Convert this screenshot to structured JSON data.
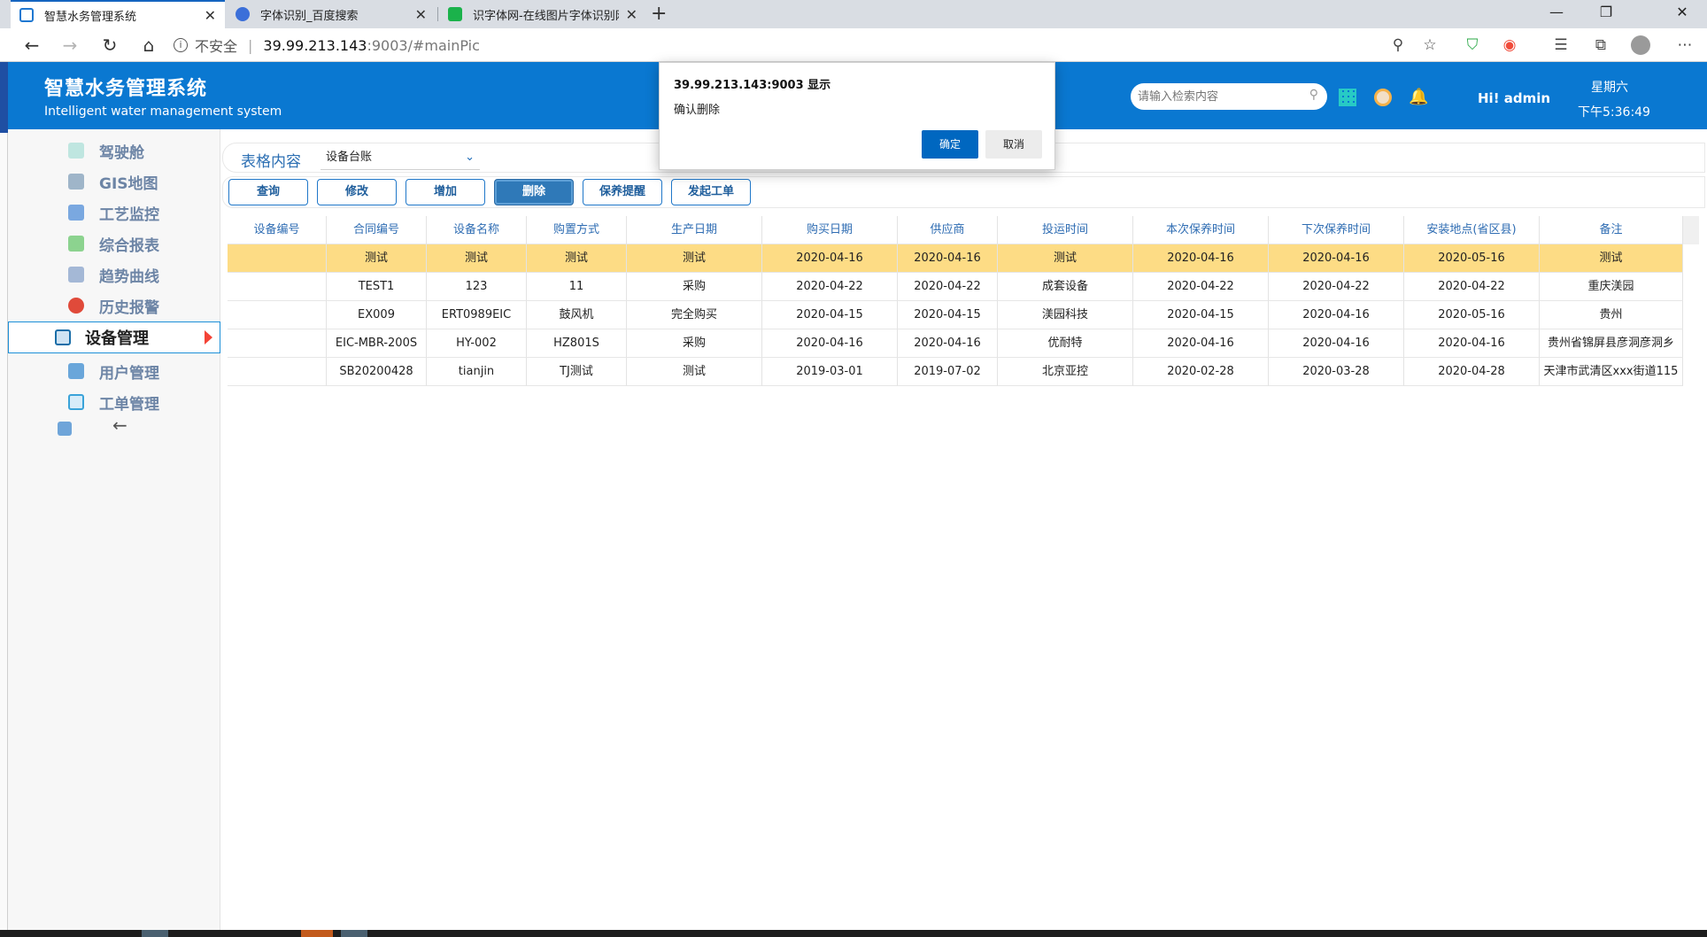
{
  "browser": {
    "tabs": [
      {
        "title": "智慧水务管理系统",
        "active": true
      },
      {
        "title": "字体识别_百度搜索",
        "active": false
      },
      {
        "title": "识字体网-在线图片字体识别网站",
        "active": false
      }
    ],
    "url": {
      "security": "不安全",
      "host": "39.99.213.143",
      "path": ":9003/#mainPic"
    },
    "icons": {
      "back": "back-arrow-icon",
      "forward": "forward-arrow-icon",
      "refresh": "refresh-icon",
      "home": "home-icon",
      "info": "info-icon",
      "zoom": "zoom-icon",
      "favorite": "star-icon",
      "shield": "shield-extension-icon",
      "extension": "extension-icon",
      "favorites": "favorites-list-icon",
      "collections": "collections-icon",
      "profile": "profile-avatar-icon",
      "more": "more-icon"
    }
  },
  "header": {
    "title": "智慧水务管理系统",
    "subtitle": "Intelligent water management system",
    "search_placeholder": "请输入检索内容",
    "greeting": "Hi!  admin",
    "weekday": "星期六",
    "time": "下午5:36:49",
    "colors": {
      "brand": "#0a78d1",
      "alert_arrow": "#f44336"
    }
  },
  "sidebar": {
    "items": [
      {
        "label": "驾驶舱",
        "icon": "dashboard-icon"
      },
      {
        "label": "GIS地图",
        "icon": "map-icon"
      },
      {
        "label": "工艺监控",
        "icon": "monitor-icon"
      },
      {
        "label": "综合报表",
        "icon": "report-icon"
      },
      {
        "label": "趋势曲线",
        "icon": "trend-icon"
      },
      {
        "label": "历史报警",
        "icon": "alarm-icon"
      },
      {
        "label": "设备管理",
        "icon": "device-icon",
        "active": true
      },
      {
        "label": "用户管理",
        "icon": "user-icon"
      },
      {
        "label": "工单管理",
        "icon": "workorder-icon"
      }
    ],
    "back_label": "←"
  },
  "filter": {
    "label": "表格内容",
    "selected": "设备台账"
  },
  "toolbar": {
    "buttons": [
      "查询",
      "修改",
      "增加",
      "删除",
      "保养提醒",
      "发起工单"
    ],
    "active_index": 3
  },
  "table": {
    "columns": [
      "设备编号",
      "合同编号",
      "设备名称",
      "购置方式",
      "生产日期",
      "购买日期",
      "供应商",
      "投运时间",
      "本次保养时间",
      "下次保养时间",
      "安装地点(省区县)",
      "备注"
    ],
    "rows": [
      [
        "",
        "测试",
        "测试",
        "测试",
        "测试",
        "2020-04-16",
        "2020-04-16",
        "测试",
        "2020-04-16",
        "2020-04-16",
        "2020-05-16",
        "测试"
      ],
      [
        "",
        "TEST1",
        "123",
        "11",
        "采购",
        "2020-04-22",
        "2020-04-22",
        "成套设备",
        "2020-04-22",
        "2020-04-22",
        "2020-04-22",
        "重庆渼园"
      ],
      [
        "",
        "EX009",
        "ERT0989EIC",
        "鼓风机",
        "完全购买",
        "2020-04-15",
        "2020-04-15",
        "渼园科技",
        "2020-04-15",
        "2020-04-16",
        "2020-05-16",
        "贵州"
      ],
      [
        "",
        "EIC-MBR-200S",
        "HY-002",
        "HZ801S",
        "采购",
        "2020-04-16",
        "2020-04-16",
        "优耐特",
        "2020-04-16",
        "2020-04-16",
        "2020-04-16",
        "贵州省锦屏县彦洞彦洞乡"
      ],
      [
        "",
        "SB20200428",
        "tianjin",
        "TJ测试",
        "测试",
        "2019-03-01",
        "2019-07-02",
        "北京亚控",
        "2020-02-28",
        "2020-03-28",
        "2020-04-28",
        "天津市武清区xxx街道115"
      ]
    ],
    "selected_row": 0,
    "selected_color": "#fddc85"
  },
  "dialog": {
    "title": "39.99.213.143:9003 显示",
    "message": "确认删除",
    "ok": "确定",
    "cancel": "取消"
  }
}
